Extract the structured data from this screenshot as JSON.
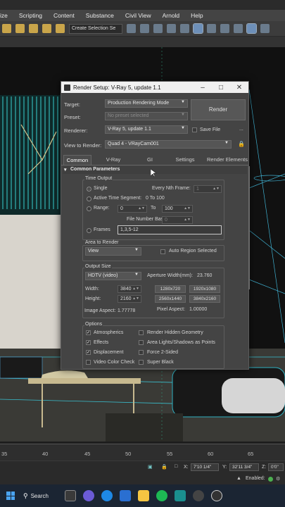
{
  "menubar": [
    "ize",
    "Scripting",
    "Content",
    "Substance",
    "Civil View",
    "Arnold",
    "Help"
  ],
  "toolbar": {
    "selection_set": "Create Selection Se"
  },
  "ruler": {
    "labels": [
      "35",
      "40",
      "45",
      "50",
      "55",
      "60",
      "65"
    ]
  },
  "status": {
    "x_label": "X:",
    "x_value": "7'10 1/4\"",
    "y_label": "Y:",
    "y_value": "32'11 3/4\"",
    "z_label": "Z:",
    "z_value": "0'0\"",
    "enabled": "Enabled:"
  },
  "taskbar": {
    "search": "Search"
  },
  "dialog": {
    "title": "Render Setup: V-Ray 5, update 1.1",
    "target_label": "Target:",
    "target_value": "Production Rendering Mode",
    "preset_label": "Preset:",
    "preset_value": "No preset selected",
    "renderer_label": "Renderer:",
    "renderer_value": "V-Ray 5, update 1.1",
    "save_file": "Save File",
    "ellipsis": "...",
    "render_button": "Render",
    "view_label": "View to Render:",
    "view_value": "Quad 4 - VRayCam001",
    "tabs": [
      "Common",
      "V-Ray",
      "GI",
      "Settings",
      "Render Elements"
    ],
    "rollout": "Common Parameters",
    "time_output": {
      "title": "Time Output",
      "single": "Single",
      "every_nth": "Every Nth Frame:",
      "every_nth_value": "1",
      "active_segment": "Active Time Segment:",
      "active_segment_value": "0 To 100",
      "range": "Range:",
      "range_from": "0",
      "to": "To",
      "range_to": "100",
      "file_number_base": "File Number Base:",
      "file_number_base_value": "0",
      "frames": "Frames",
      "frames_value": "1,3,5-12"
    },
    "area": {
      "title": "Area to Render",
      "view": "View",
      "auto_region": "Auto Region Selected"
    },
    "output_size": {
      "title": "Output Size",
      "format": "HDTV (video)",
      "aperture_label": "Aperture Width(mm):",
      "aperture_value": "23.760",
      "width_label": "Width:",
      "width_value": "3840",
      "height_label": "Height:",
      "height_value": "2160",
      "presets": [
        "1280x720",
        "1920x1080",
        "2560x1440",
        "3840x2160"
      ],
      "image_aspect_label": "Image Aspect:",
      "image_aspect_value": "1.77778",
      "pixel_aspect_label": "Pixel Aspect:",
      "pixel_aspect_value": "1.00000"
    },
    "options": {
      "title": "Options",
      "atmospherics": "Atmospherics",
      "render_hidden": "Render Hidden Geometry",
      "effects": "Effects",
      "area_lights": "Area Lights/Shadows as Points",
      "displacement": "Displacement",
      "force_2sided": "Force 2-Sided",
      "video_color_check": "Video Color Check",
      "super_black": "Super Black"
    }
  }
}
